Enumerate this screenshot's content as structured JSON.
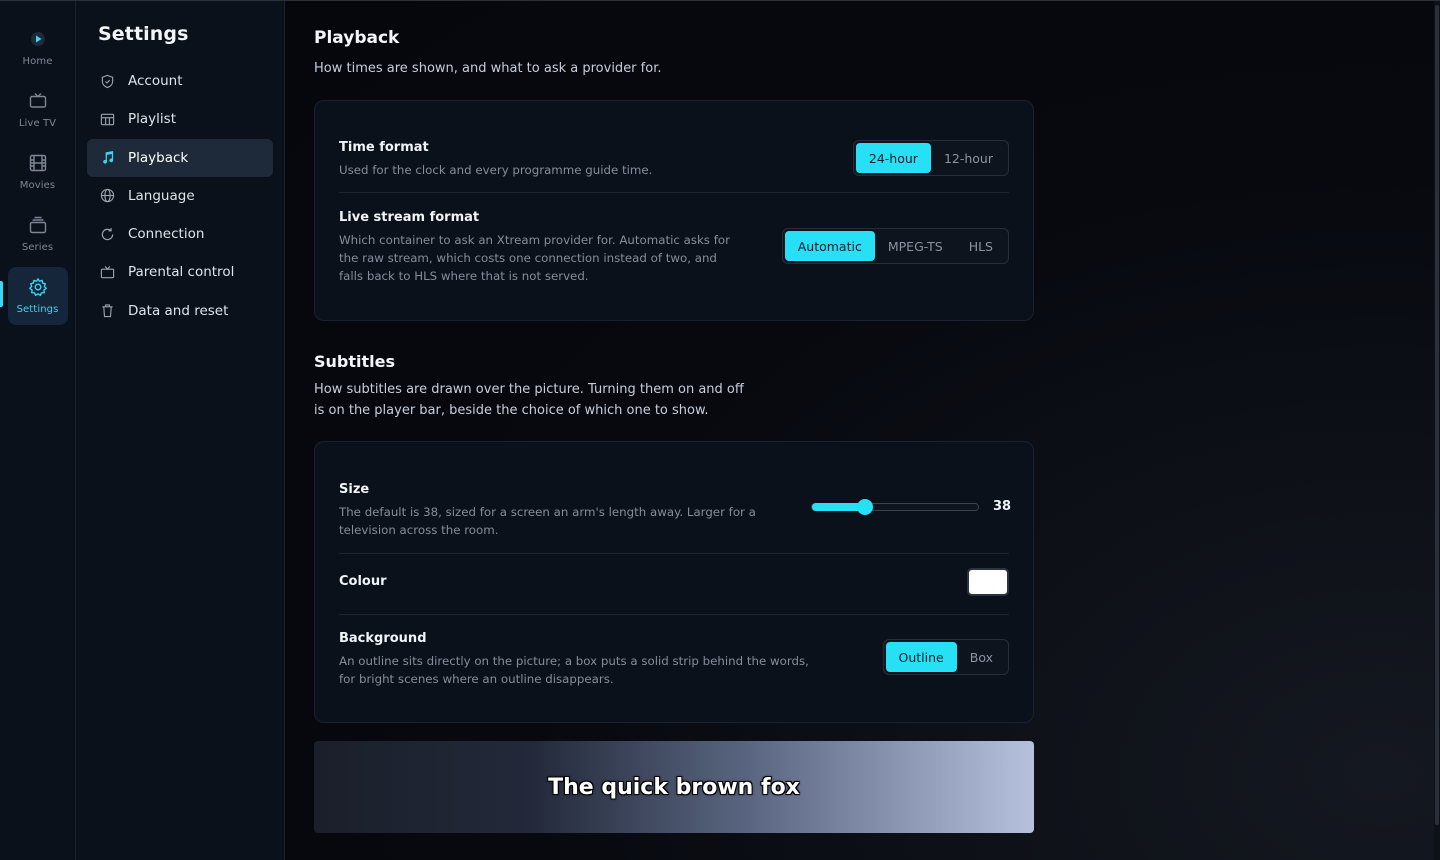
{
  "colors": {
    "accent": "#27e0f5",
    "subtitle_colour": "#ffffff"
  },
  "rail": {
    "items": [
      {
        "label": "Home",
        "icon": "home-logo-icon"
      },
      {
        "label": "Live TV",
        "icon": "tv-icon"
      },
      {
        "label": "Movies",
        "icon": "film-icon"
      },
      {
        "label": "Series",
        "icon": "series-stack-icon"
      },
      {
        "label": "Settings",
        "icon": "gear-icon",
        "active": true
      }
    ]
  },
  "sidebar": {
    "title": "Settings",
    "items": [
      {
        "label": "Account",
        "icon": "shield-icon"
      },
      {
        "label": "Playlist",
        "icon": "table-icon"
      },
      {
        "label": "Playback",
        "icon": "music-note-icon",
        "active": true
      },
      {
        "label": "Language",
        "icon": "globe-icon"
      },
      {
        "label": "Connection",
        "icon": "refresh-icon"
      },
      {
        "label": "Parental control",
        "icon": "tv-icon"
      },
      {
        "label": "Data and reset",
        "icon": "trash-icon"
      }
    ]
  },
  "playback": {
    "title": "Playback",
    "description": "How times are shown, and what to ask a provider for.",
    "time_format": {
      "label": "Time format",
      "help": "Used for the clock and every programme guide time.",
      "options": [
        "24-hour",
        "12-hour"
      ],
      "selected": "24-hour"
    },
    "live_stream_format": {
      "label": "Live stream format",
      "help": "Which container to ask an Xtream provider for. Automatic asks for the raw stream, which costs one connection instead of two, and falls back to HLS where that is not served.",
      "options": [
        "Automatic",
        "MPEG-TS",
        "HLS"
      ],
      "selected": "Automatic"
    }
  },
  "subtitles": {
    "title": "Subtitles",
    "description": "How subtitles are drawn over the picture. Turning them on and off is on the player bar, beside the choice of which one to show.",
    "size": {
      "label": "Size",
      "help": "The default is 38, sized for a screen an arm's length away. Larger for a television across the room.",
      "value": "38",
      "fill_fraction": 0.32
    },
    "colour": {
      "label": "Colour"
    },
    "background": {
      "label": "Background",
      "help": "An outline sits directly on the picture; a box puts a solid strip behind the words, for bright scenes where an outline disappears.",
      "options": [
        "Outline",
        "Box"
      ],
      "selected": "Outline"
    },
    "preview_text": "The quick brown fox"
  }
}
